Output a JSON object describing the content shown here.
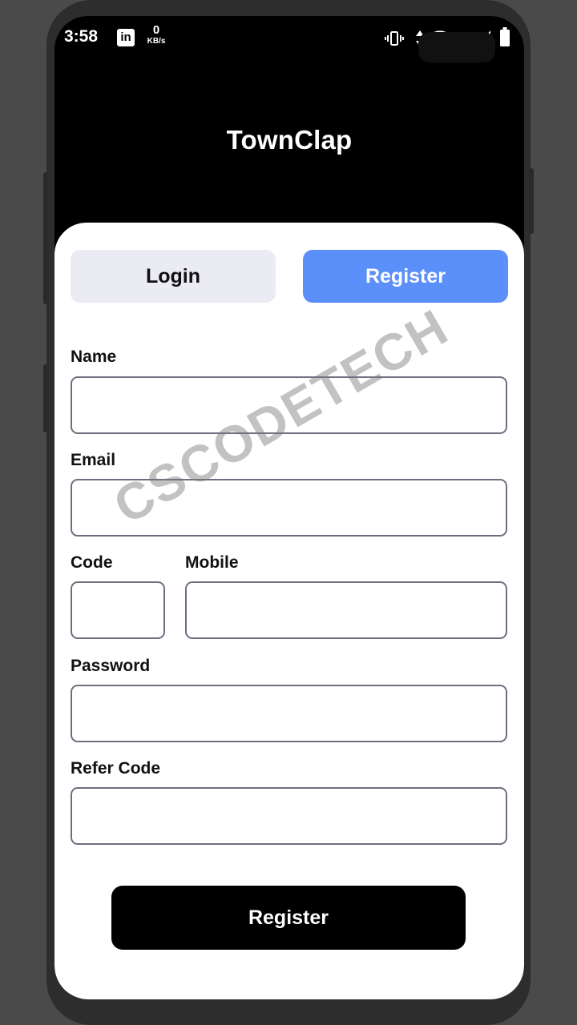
{
  "status_bar": {
    "time": "3:58",
    "linkedin_icon": "in",
    "speed_value": "0",
    "speed_unit": "KB/s",
    "icons": [
      "linkedin-icon",
      "vibrate-icon",
      "network-arrows-icon",
      "wifi-icon",
      "signal-icon",
      "battery-icon"
    ]
  },
  "header": {
    "title": "TownClap"
  },
  "tabs": {
    "login": "Login",
    "register": "Register"
  },
  "form": {
    "name_label": "Name",
    "email_label": "Email",
    "code_label": "Code",
    "mobile_label": "Mobile",
    "password_label": "Password",
    "refer_label": "Refer Code",
    "submit_label": "Register"
  },
  "watermark": "CSCODETECH",
  "colors": {
    "accent": "#5b8ff9",
    "inactive_tab": "#ebebf3",
    "header_bg": "#000000",
    "submit_bg": "#000000",
    "input_border": "#6e6e80"
  }
}
